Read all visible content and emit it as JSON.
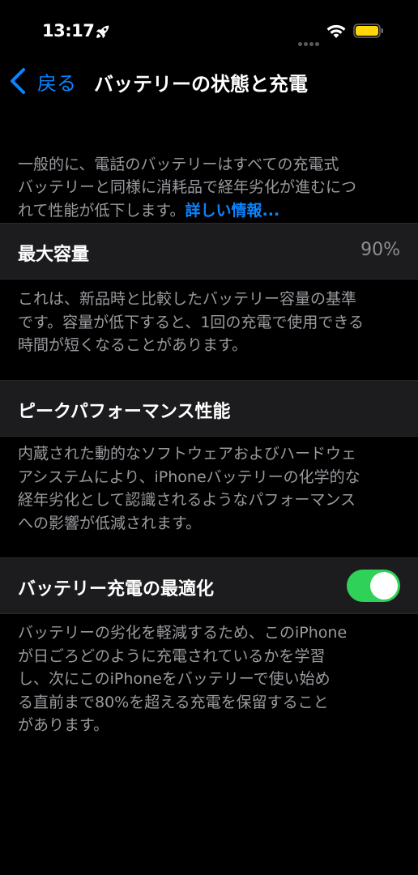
{
  "status": {
    "time": "13:17"
  },
  "nav": {
    "back_label": "戻る",
    "title": "バッテリーの状態と充電"
  },
  "intro": {
    "text": "一般的に、電話のバッテリーはすべての充電式\nバッテリーと同様に消耗品で経年劣化が進むにつ\nれて性能が低下します。",
    "link": "詳しい情報..."
  },
  "capacity": {
    "label": "最大容量",
    "value": "90%",
    "footer": "これは、新品時と比較したバッテリー容量の基準\nです。容量が低下すると、1回の充電で使用できる\n時間が短くなることがあります。"
  },
  "peak": {
    "label": "ピークパフォーマンス性能",
    "footer": "内蔵された動的なソフトウェアおよびハードウェ\nアシステムにより、iPhoneバッテリーの化学的な\n経年劣化として認識されるようなパフォーマンス\nへの影響が低減されます。"
  },
  "optimized": {
    "label": "バッテリー充電の最適化",
    "enabled": true,
    "footer": "バッテリーの劣化を軽減するため、このiPhone\nが日ごろどのように充電されているかを学習\nし、次にこのiPhoneをバッテリーで使い始め\nる直前まで80%を超える充電を保留すること\nがあります。"
  },
  "colors": {
    "accent": "#0a84ff",
    "toggle_on": "#30d158",
    "battery": "#ffd60a"
  },
  "icons": [
    "rocket-icon",
    "wifi-icon",
    "battery-icon",
    "chevron-left-icon"
  ]
}
